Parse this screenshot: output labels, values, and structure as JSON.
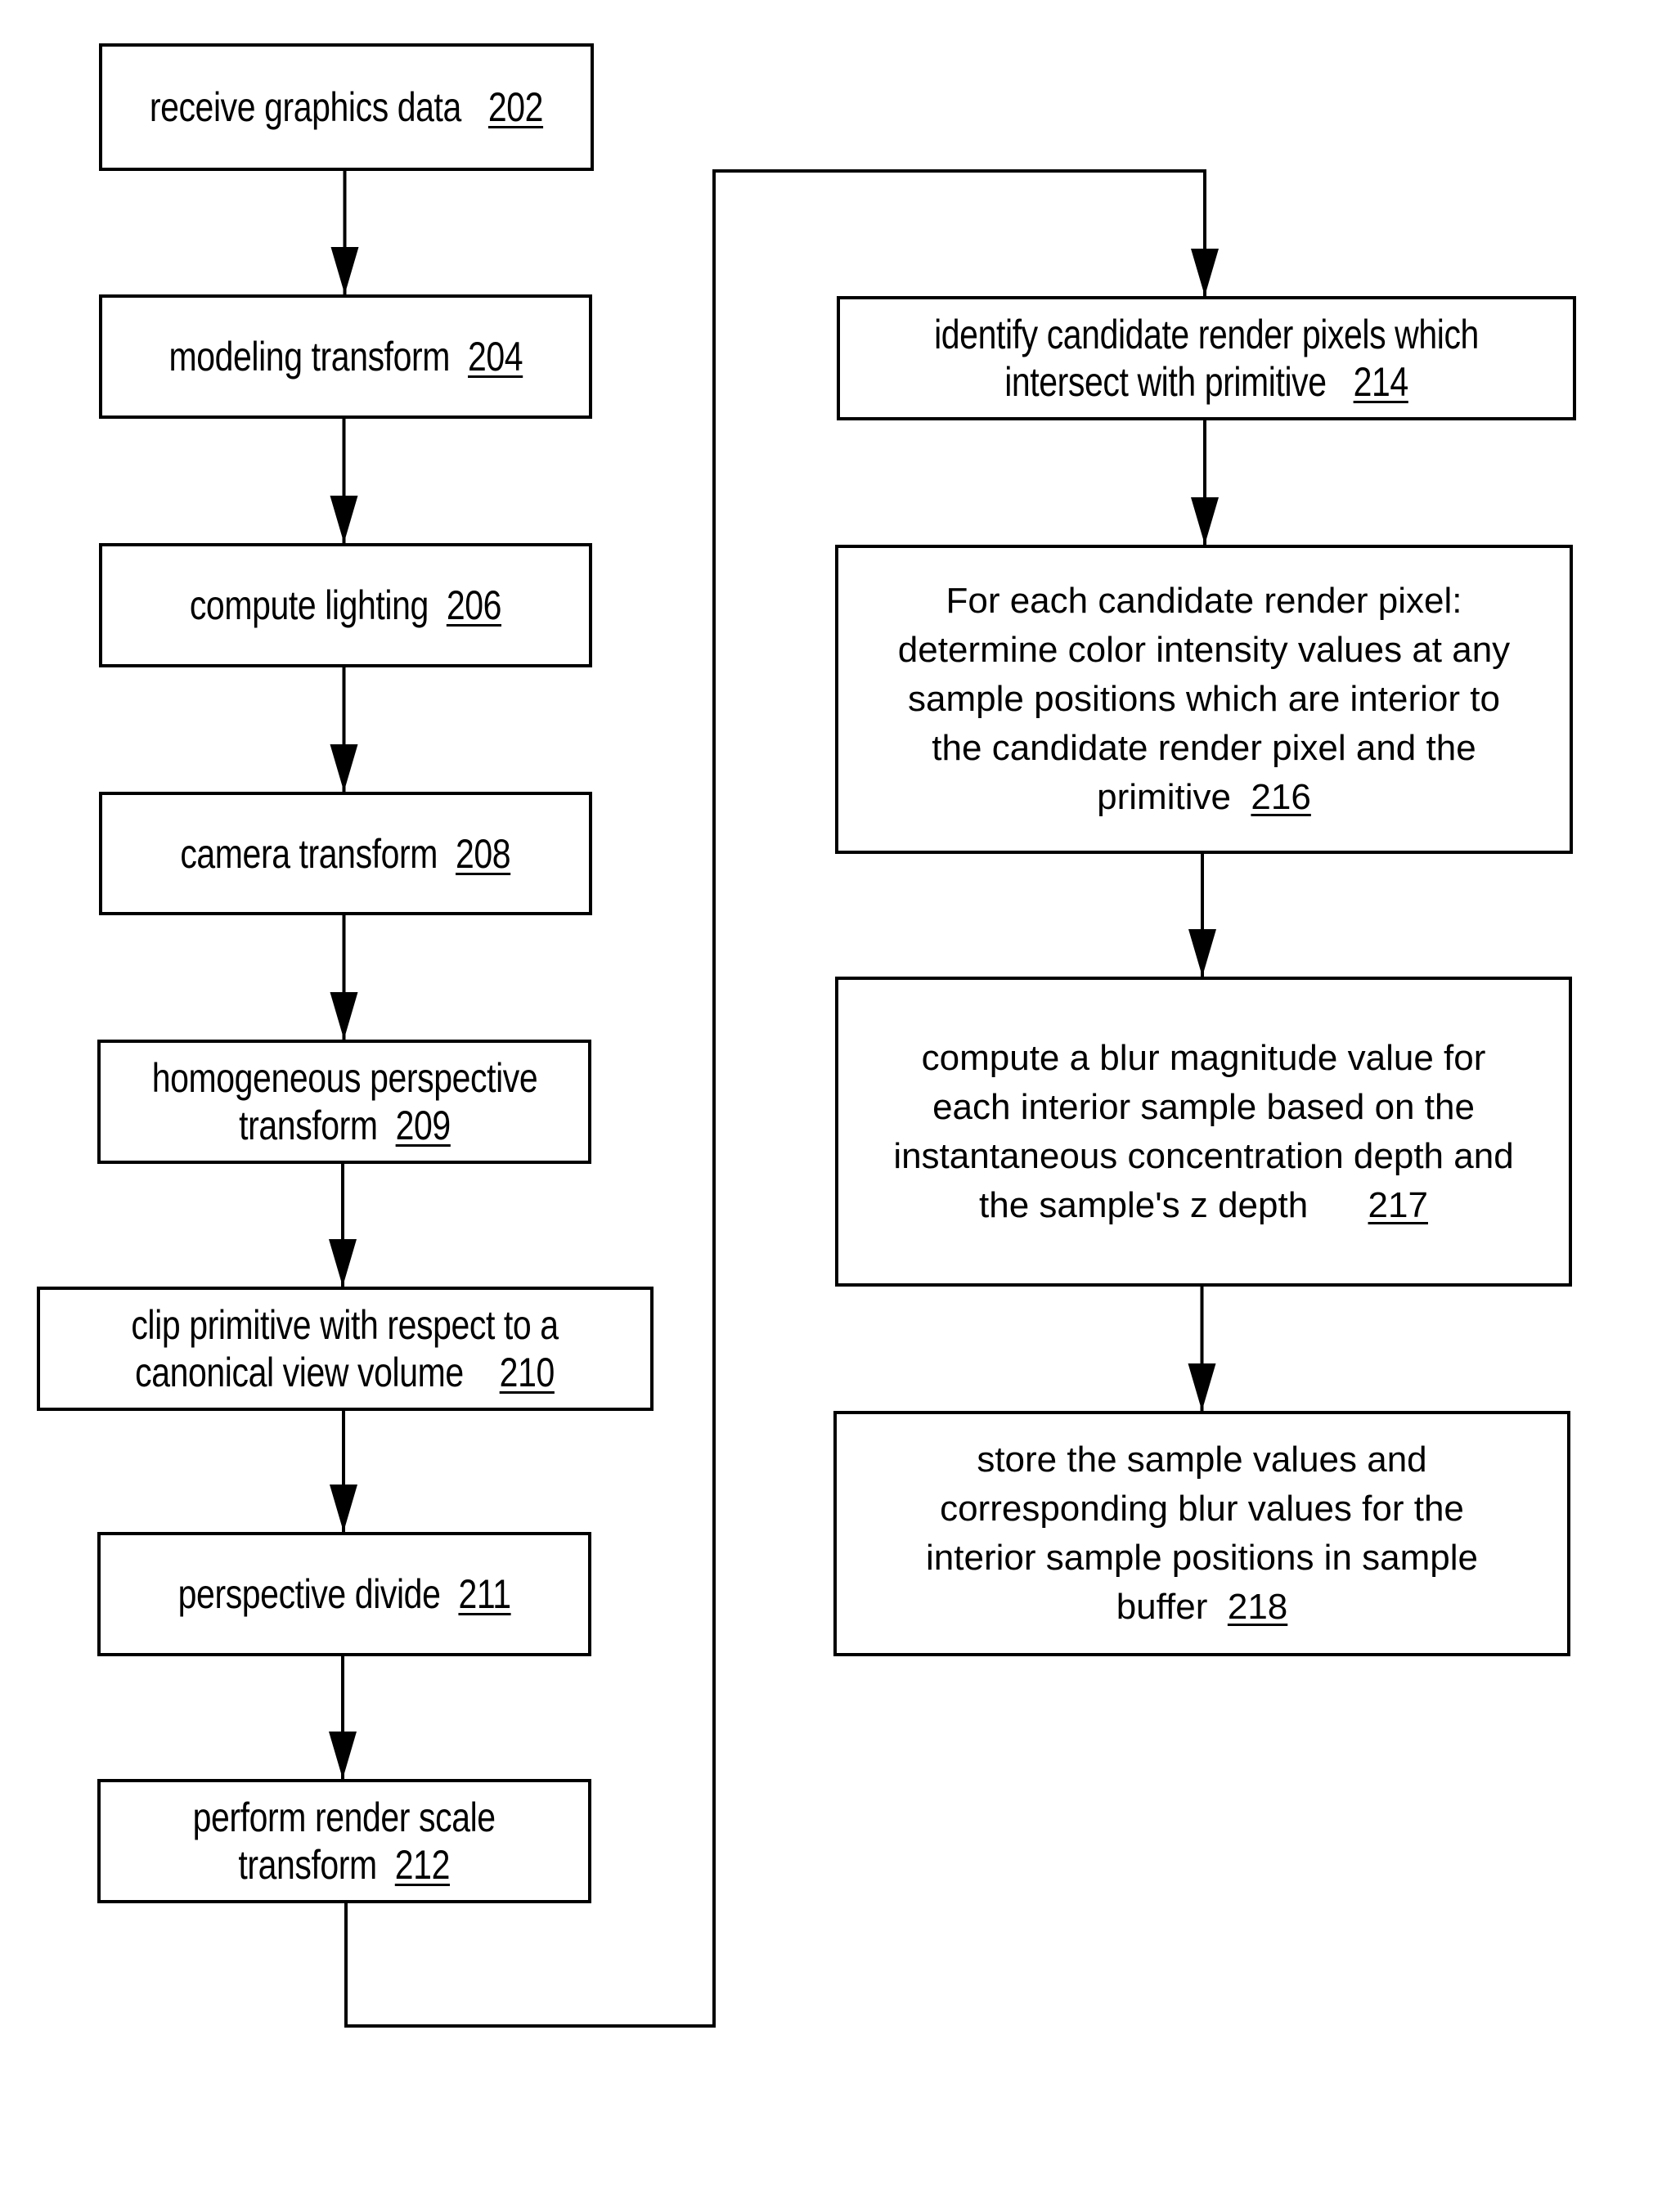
{
  "diagram": {
    "type": "flowchart",
    "steps": [
      {
        "id": "202",
        "text": "receive graphics data",
        "ref": "202"
      },
      {
        "id": "204",
        "text": "modeling transform",
        "ref": "204"
      },
      {
        "id": "206",
        "text": "compute lighting",
        "ref": "206"
      },
      {
        "id": "208",
        "text": "camera transform",
        "ref": "208"
      },
      {
        "id": "209",
        "lines": [
          "homogeneous perspective",
          "transform"
        ],
        "ref": "209"
      },
      {
        "id": "210",
        "lines": [
          "clip primitive with respect to a",
          "canonical view volume"
        ],
        "ref": "210"
      },
      {
        "id": "211",
        "text": "perspective divide",
        "ref": "211"
      },
      {
        "id": "212",
        "lines": [
          "perform render scale",
          "transform"
        ],
        "ref": "212"
      },
      {
        "id": "214",
        "lines": [
          "identify candidate render pixels which",
          "intersect with primitive"
        ],
        "ref": "214"
      },
      {
        "id": "216",
        "lines": [
          "For each candidate render pixel:",
          "determine color intensity values at any",
          "sample positions which are interior to",
          "the candidate render pixel and the",
          "primitive"
        ],
        "ref": "216"
      },
      {
        "id": "217",
        "lines": [
          "compute a blur magnitude value for",
          "each interior sample based on the",
          "instantaneous concentration depth and",
          "the sample's z depth"
        ],
        "ref": "217"
      },
      {
        "id": "218",
        "lines": [
          "store the sample values and",
          "corresponding blur values for the",
          "interior sample positions in sample",
          "buffer"
        ],
        "ref": "218"
      }
    ],
    "edges": [
      [
        "202",
        "204"
      ],
      [
        "204",
        "206"
      ],
      [
        "206",
        "208"
      ],
      [
        "208",
        "209"
      ],
      [
        "209",
        "210"
      ],
      [
        "210",
        "211"
      ],
      [
        "211",
        "212"
      ],
      [
        "212",
        "214"
      ],
      [
        "214",
        "216"
      ],
      [
        "216",
        "217"
      ],
      [
        "217",
        "218"
      ]
    ]
  }
}
